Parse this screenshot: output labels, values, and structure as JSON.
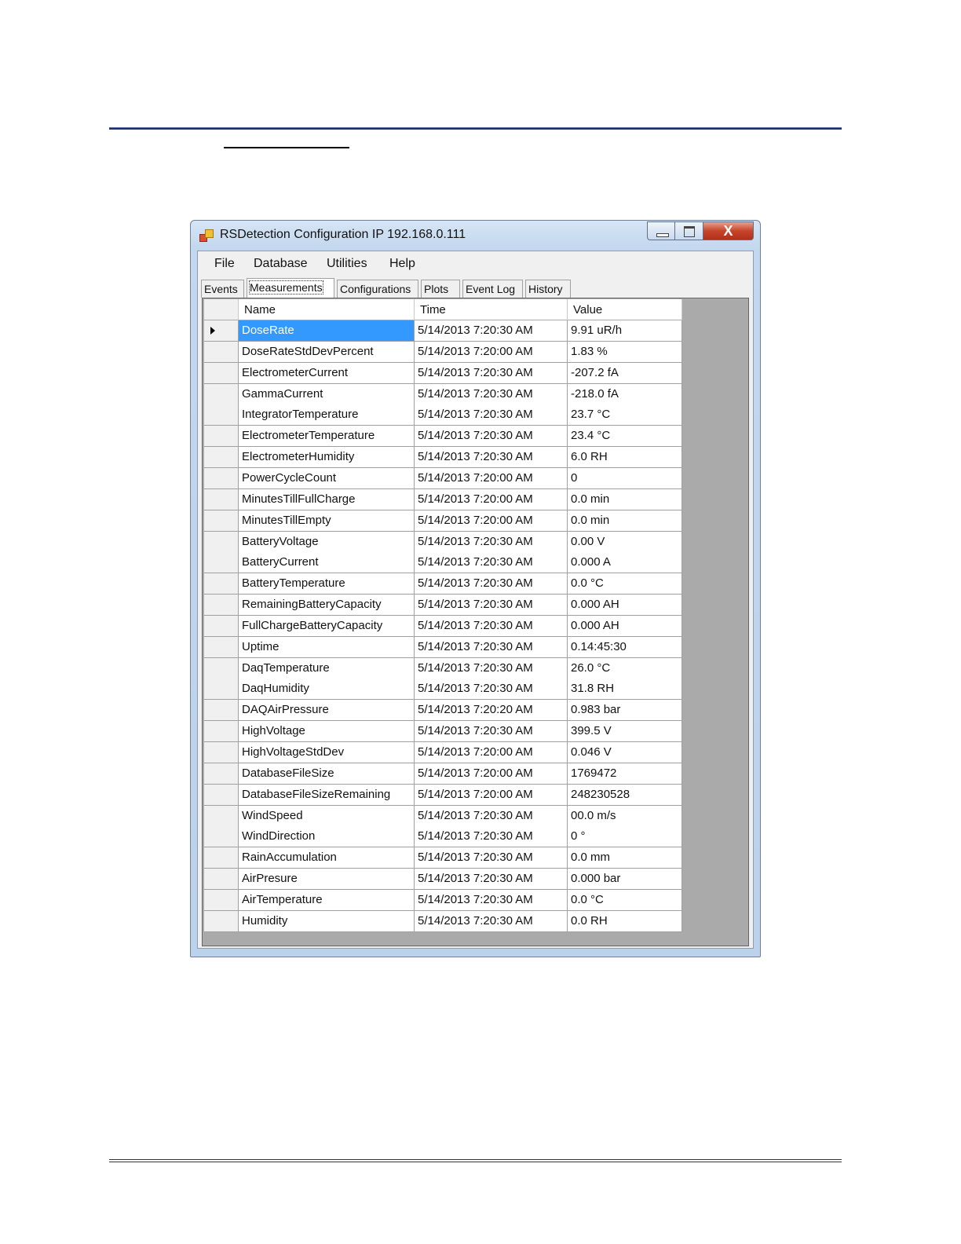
{
  "window": {
    "title": "RSDetection Configuration IP 192.168.0.111",
    "close_glyph": "X"
  },
  "menu": [
    "File",
    "Database",
    "Utilities",
    "Help"
  ],
  "tabs": [
    {
      "label": "Events",
      "active": false
    },
    {
      "label": "Measurements",
      "active": true
    },
    {
      "label": "Configurations",
      "active": false
    },
    {
      "label": "Plots",
      "active": false
    },
    {
      "label": "Event Log",
      "active": false
    },
    {
      "label": "History",
      "active": false
    }
  ],
  "grid": {
    "columns": [
      "Name",
      "Time",
      "Value"
    ],
    "selected_row": 0,
    "rows": [
      {
        "name": "DoseRate",
        "time": "5/14/2013 7:20:30 AM",
        "value": "9.91 uR/h"
      },
      {
        "name": "DoseRateStdDevPercent",
        "time": "5/14/2013 7:20:00 AM",
        "value": "1.83 %"
      },
      {
        "name": "ElectrometerCurrent",
        "time": "5/14/2013 7:20:30 AM",
        "value": "-207.2 fA"
      },
      {
        "name": "GammaCurrent",
        "time": "5/14/2013 7:20:30 AM",
        "value": "-218.0 fA"
      },
      {
        "name": "IntegratorTemperature",
        "time": "5/14/2013 7:20:30 AM",
        "value": "23.7 °C"
      },
      {
        "name": "ElectrometerTemperature",
        "time": "5/14/2013 7:20:30 AM",
        "value": "23.4 °C"
      },
      {
        "name": "ElectrometerHumidity",
        "time": "5/14/2013 7:20:30 AM",
        "value": "6.0 RH"
      },
      {
        "name": "PowerCycleCount",
        "time": "5/14/2013 7:20:00 AM",
        "value": "0"
      },
      {
        "name": "MinutesTillFullCharge",
        "time": "5/14/2013 7:20:00 AM",
        "value": "0.0 min"
      },
      {
        "name": "MinutesTillEmpty",
        "time": "5/14/2013 7:20:00 AM",
        "value": "0.0 min"
      },
      {
        "name": "BatteryVoltage",
        "time": "5/14/2013 7:20:30 AM",
        "value": "0.00 V"
      },
      {
        "name": "BatteryCurrent",
        "time": "5/14/2013 7:20:30 AM",
        "value": "0.000 A"
      },
      {
        "name": "BatteryTemperature",
        "time": "5/14/2013 7:20:30 AM",
        "value": "0.0 °C"
      },
      {
        "name": "RemainingBatteryCapacity",
        "time": "5/14/2013 7:20:30 AM",
        "value": "0.000 AH"
      },
      {
        "name": "FullChargeBatteryCapacity",
        "time": "5/14/2013 7:20:30 AM",
        "value": "0.000 AH"
      },
      {
        "name": "Uptime",
        "time": "5/14/2013 7:20:30 AM",
        "value": "0.14:45:30"
      },
      {
        "name": "DaqTemperature",
        "time": "5/14/2013 7:20:30 AM",
        "value": "26.0 °C"
      },
      {
        "name": "DaqHumidity",
        "time": "5/14/2013 7:20:30 AM",
        "value": "31.8 RH"
      },
      {
        "name": "DAQAirPressure",
        "time": "5/14/2013 7:20:20 AM",
        "value": "0.983 bar"
      },
      {
        "name": "HighVoltage",
        "time": "5/14/2013 7:20:30 AM",
        "value": "399.5 V"
      },
      {
        "name": "HighVoltageStdDev",
        "time": "5/14/2013 7:20:00 AM",
        "value": "0.046 V"
      },
      {
        "name": "DatabaseFileSize",
        "time": "5/14/2013 7:20:00 AM",
        "value": "1769472"
      },
      {
        "name": "DatabaseFileSizeRemaining",
        "time": "5/14/2013 7:20:00 AM",
        "value": "248230528"
      },
      {
        "name": "WindSpeed",
        "time": "5/14/2013 7:20:30 AM",
        "value": "00.0 m/s"
      },
      {
        "name": "WindDirection",
        "time": "5/14/2013 7:20:30 AM",
        "value": "0 °"
      },
      {
        "name": "RainAccumulation",
        "time": "5/14/2013 7:20:30 AM",
        "value": "0.0 mm"
      },
      {
        "name": "AirPresure",
        "time": "5/14/2013 7:20:30 AM",
        "value": "0.000 bar"
      },
      {
        "name": "AirTemperature",
        "time": "5/14/2013 7:20:30 AM",
        "value": "0.0 °C"
      },
      {
        "name": "Humidity",
        "time": "5/14/2013 7:20:30 AM",
        "value": "0.0 RH"
      }
    ]
  },
  "colors": {
    "selection": "#3399ff",
    "grid_background": "#aaaaaa"
  }
}
